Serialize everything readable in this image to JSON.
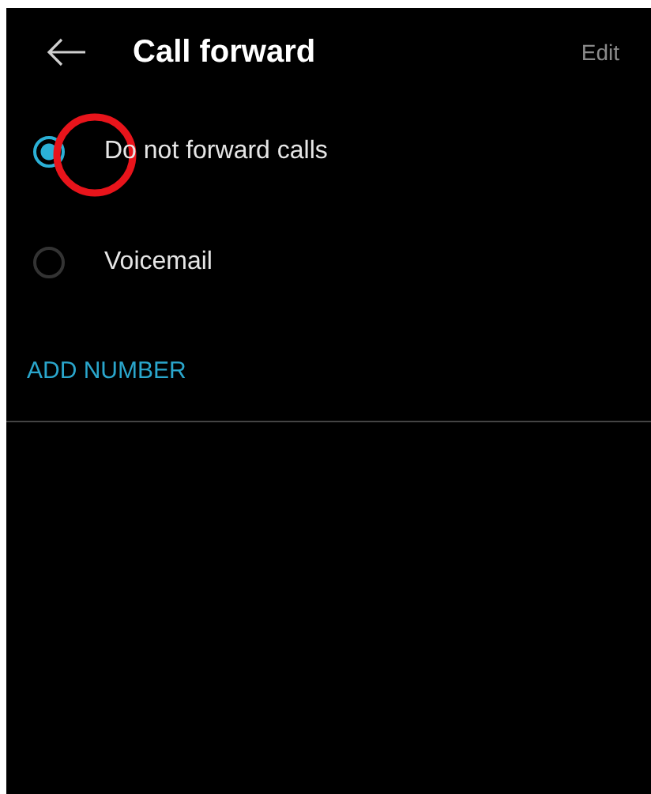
{
  "header": {
    "title": "Call forward",
    "action": "Edit"
  },
  "options": [
    {
      "label": "Do not forward calls",
      "selected": true
    },
    {
      "label": "Voicemail",
      "selected": false
    }
  ],
  "add_number": "ADD NUMBER"
}
